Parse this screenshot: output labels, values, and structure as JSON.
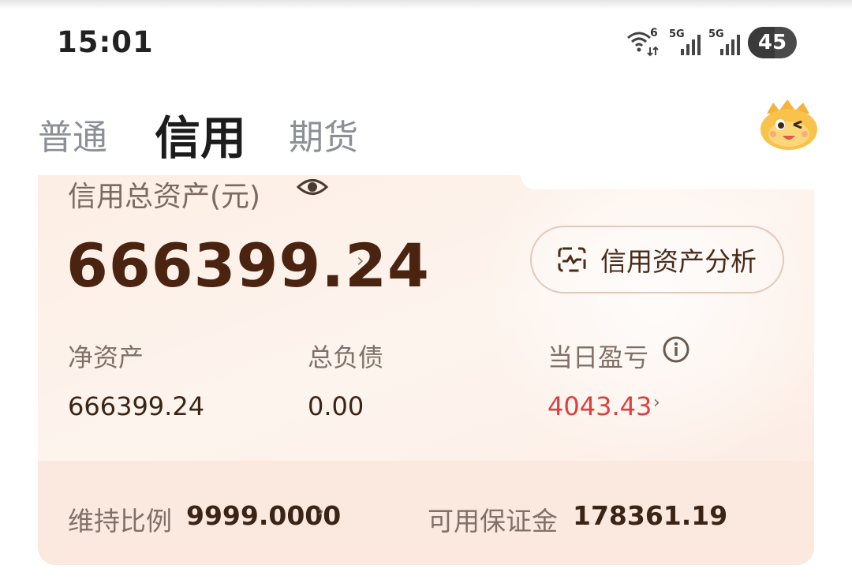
{
  "status_bar": {
    "time": "15:01",
    "wifi_label": "6",
    "sim1_label": "5G",
    "sim2_label": "5G",
    "battery": "45"
  },
  "tabs": {
    "normal": "普通",
    "credit": "信用",
    "futures": "期货"
  },
  "card": {
    "total_assets_label": "信用总资产(元)",
    "total_assets_value": "666399.24",
    "analysis_button": "信用资产分析",
    "net_assets_label": "净资产",
    "net_assets_value": "666399.24",
    "total_liabilities_label": "总负债",
    "total_liabilities_value": "0.00",
    "daily_pnl_label": "当日盈亏",
    "daily_pnl_value": "4043.43",
    "maintenance_ratio_label": "维持比例",
    "maintenance_ratio_value": "9999.0000",
    "available_margin_label": "可用保证金",
    "available_margin_value": "178361.19"
  },
  "colors": {
    "loss_gain": "#d94040",
    "card_bg": "#fdeee4",
    "value_brown": "#4a2410"
  }
}
